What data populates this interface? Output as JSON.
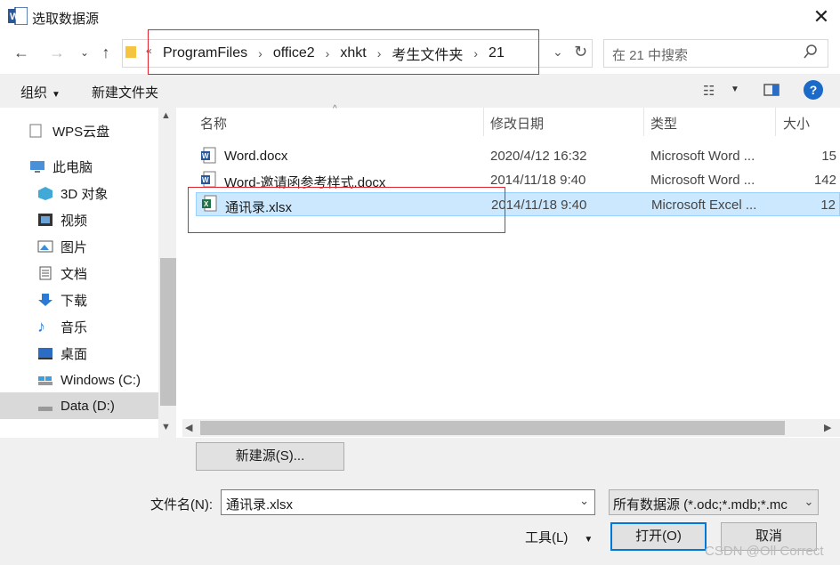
{
  "window": {
    "title": "选取数据源"
  },
  "breadcrumbs": [
    "ProgramFiles",
    "office2",
    "xhkt",
    "考生文件夹",
    "21"
  ],
  "breadcrumb_prefix": "«",
  "search": {
    "placeholder": "在 21 中搜索"
  },
  "toolbar": {
    "organize_label": "组织",
    "new_folder_label": "新建文件夹"
  },
  "sidebar": {
    "items": [
      {
        "label": "WPS云盘",
        "icon": "cloud-doc-icon"
      },
      {
        "label": "此电脑",
        "icon": "computer-icon"
      },
      {
        "label": "3D 对象",
        "icon": "cube-icon"
      },
      {
        "label": "视频",
        "icon": "video-icon"
      },
      {
        "label": "图片",
        "icon": "picture-icon"
      },
      {
        "label": "文档",
        "icon": "document-icon"
      },
      {
        "label": "下载",
        "icon": "download-icon"
      },
      {
        "label": "音乐",
        "icon": "music-icon"
      },
      {
        "label": "桌面",
        "icon": "desktop-icon"
      },
      {
        "label": "Windows (C:)",
        "icon": "drive-icon"
      },
      {
        "label": "Data (D:)",
        "icon": "drive-icon"
      }
    ]
  },
  "columns": {
    "name": "名称",
    "modified": "修改日期",
    "type": "类型",
    "size": "大小"
  },
  "files": [
    {
      "name": "Word.docx",
      "modified": "2020/4/12 16:32",
      "type": "Microsoft Word ...",
      "size": "15",
      "icon": "word-file-icon"
    },
    {
      "name": "Word-邀请函参考样式.docx",
      "modified": "2014/11/18 9:40",
      "type": "Microsoft Word ...",
      "size": "142",
      "icon": "word-file-icon"
    },
    {
      "name": "通讯录.xlsx",
      "modified": "2014/11/18 9:40",
      "type": "Microsoft Excel ...",
      "size": "12",
      "icon": "excel-file-icon",
      "selected": true
    }
  ],
  "buttons": {
    "new_source": "新建源(S)...",
    "open": "打开(O)",
    "cancel": "取消",
    "tools": "工具(L)"
  },
  "filename": {
    "label": "文件名(N):",
    "value": "通讯录.xlsx"
  },
  "filetype": {
    "value": "所有数据源 (*.odc;*.mdb;*.mc"
  },
  "watermark": "CSDN @Oll Correct",
  "colors": {
    "selected_row": "#cce8ff",
    "highlight_box": "#e3262e",
    "help": "#1b6ac9"
  }
}
